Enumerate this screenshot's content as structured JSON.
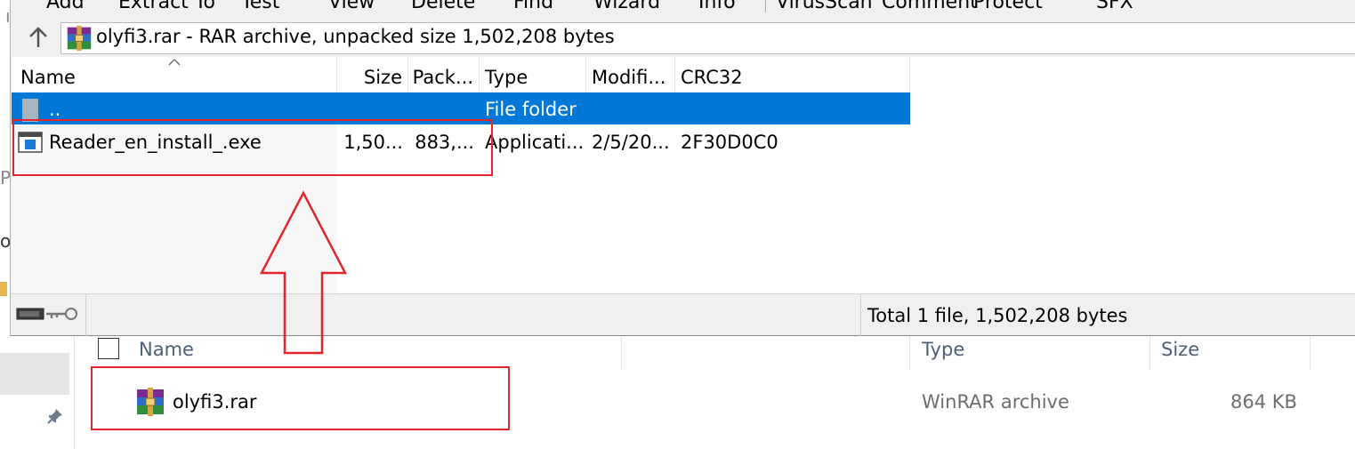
{
  "winrar": {
    "toolbar": [
      "Add",
      "Extract To",
      "Test",
      "View",
      "Delete",
      "Find",
      "Wizard",
      "Info",
      "VirusScan",
      "Comment",
      "Protect",
      "SFX"
    ],
    "address": "olyfi3.rar - RAR archive, unpacked size 1,502,208 bytes",
    "columns": [
      "Name",
      "Size",
      "Pack...",
      "Type",
      "Modifi...",
      "CRC32"
    ],
    "rows": [
      {
        "name": "..",
        "size": "",
        "packed": "",
        "type": "File folder",
        "modified": "",
        "crc": ""
      },
      {
        "name": "Reader_en_install_.exe",
        "size": "1,50...",
        "packed": "883,...",
        "type": "Applicati...",
        "modified": "2/5/20...",
        "crc": "2F30D0C0"
      }
    ],
    "status": "Total 1 file, 1,502,208 bytes"
  },
  "explorer": {
    "left_fragments": [
      "ıl",
      "P",
      "ob"
    ],
    "columns": [
      "Name",
      "Type",
      "Size"
    ],
    "rows": [
      {
        "name": "olyfi3.rar",
        "type": "WinRAR archive",
        "size": "864 KB"
      }
    ]
  },
  "colors": {
    "selection": "#0078d7",
    "annotation": "#e3262b",
    "header_text": "#4c607a"
  }
}
